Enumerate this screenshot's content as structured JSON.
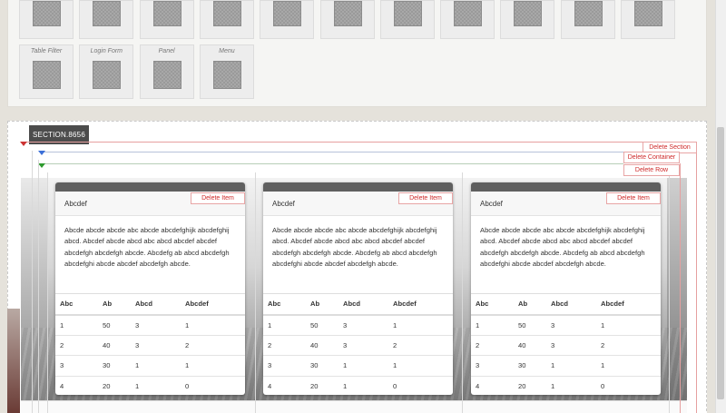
{
  "palette": {
    "row1_count": 11,
    "row2": [
      {
        "label": "Table Filter"
      },
      {
        "label": "Login Form"
      },
      {
        "label": "Panel"
      },
      {
        "label": "Menu"
      }
    ]
  },
  "section": {
    "tag": "SECTION.8656",
    "delete_section": "Delete Section",
    "delete_container": "Delete Container",
    "delete_row": "Delete Row"
  },
  "colors": {
    "guide_section": "#e6a0a0",
    "guide_container": "#3b6fd8",
    "guide_row": "#2e9b2e",
    "delete_text": "#cf2a2a",
    "card_header_bar": "#5f5f5f"
  },
  "cards": [
    {
      "delete_label": "Delete Item",
      "title": "Abcdef",
      "body": "Abcde abcde abcde abc abcde abcdefghijk abcdefghij abcd. Abcdef abcde abcd abc abcd abcdef abcdef abcdefgh abcdefgh abcde. Abcdefg ab abcd abcdefgh abcdefghi abcde abcdef abcdefgh abcde.",
      "headers": [
        "Abc",
        "Ab",
        "Abcd",
        "Abcdef"
      ],
      "rows": [
        [
          "1",
          "50",
          "3",
          "1"
        ],
        [
          "2",
          "40",
          "3",
          "2"
        ],
        [
          "3",
          "30",
          "1",
          "1"
        ],
        [
          "4",
          "20",
          "1",
          "0"
        ]
      ]
    },
    {
      "delete_label": "Delete Item",
      "title": "Abcdef",
      "body": "Abcde abcde abcde abc abcde abcdefghijk abcdefghij abcd. Abcdef abcde abcd abc abcd abcdef abcdef abcdefgh abcdefgh abcde. Abcdefg ab abcd abcdefgh abcdefghi abcde abcdef abcdefgh abcde.",
      "headers": [
        "Abc",
        "Ab",
        "Abcd",
        "Abcdef"
      ],
      "rows": [
        [
          "1",
          "50",
          "3",
          "1"
        ],
        [
          "2",
          "40",
          "3",
          "2"
        ],
        [
          "3",
          "30",
          "1",
          "1"
        ],
        [
          "4",
          "20",
          "1",
          "0"
        ]
      ]
    },
    {
      "delete_label": "Delete Item",
      "title": "Abcdef",
      "body": "Abcde abcde abcde abc abcde abcdefghijk abcdefghij abcd. Abcdef abcde abcd abc abcd abcdef abcdef abcdefgh abcdefgh abcde. Abcdefg ab abcd abcdefgh abcdefghi abcde abcdef abcdefgh abcde.",
      "headers": [
        "Abc",
        "Ab",
        "Abcd",
        "Abcdef"
      ],
      "rows": [
        [
          "1",
          "50",
          "3",
          "1"
        ],
        [
          "2",
          "40",
          "3",
          "2"
        ],
        [
          "3",
          "30",
          "1",
          "1"
        ],
        [
          "4",
          "20",
          "1",
          "0"
        ]
      ]
    }
  ]
}
